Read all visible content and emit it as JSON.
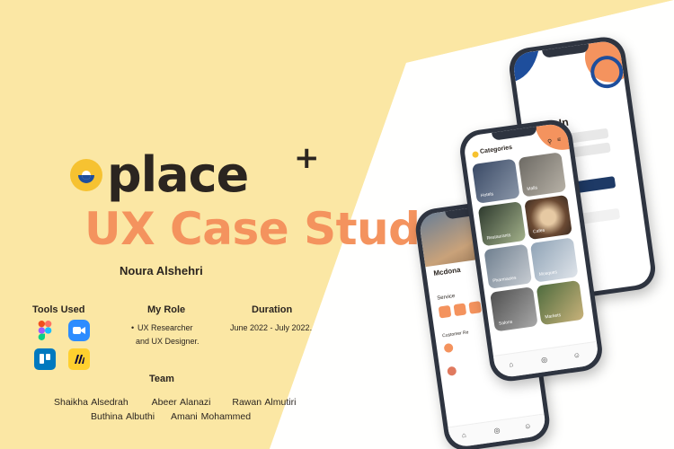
{
  "brand": {
    "name": "place",
    "superscript": "+"
  },
  "title": "UX Case Study",
  "author": "Noura Alshehri",
  "tools": {
    "heading": "Tools Used",
    "icons": [
      "figma-icon",
      "zoom-icon",
      "trello-icon",
      "miro-icon"
    ]
  },
  "role": {
    "heading": "My Role",
    "line1": "UX Researcher",
    "line2": "and UX Designer."
  },
  "duration": {
    "heading": "Duration",
    "text": "June 2022 - July 2022."
  },
  "team": {
    "heading": "Team",
    "row1": [
      "Shaikha Alsedrah",
      "Abeer Alanazi",
      "Rawan Almutiri"
    ],
    "row2": [
      "Buthina Albuthi",
      "Amani Mohammed"
    ]
  },
  "phone_signin": {
    "title": "Sign In"
  },
  "phone_categories": {
    "title": "Categories",
    "tiles": [
      "Hotels",
      "Malls",
      "Restaurants",
      "Cafes",
      "Pharmacies",
      "Mosques",
      "Salons",
      "Markets"
    ]
  },
  "phone_detail": {
    "title": "Mcdona",
    "section": "Service",
    "reviews": "Customer Re"
  },
  "colors": {
    "background": "#fbe7a4",
    "accent": "#f4935e",
    "dark": "#2b2520",
    "logo_blue": "#1e4e9c",
    "logo_yellow": "#f6c231"
  }
}
